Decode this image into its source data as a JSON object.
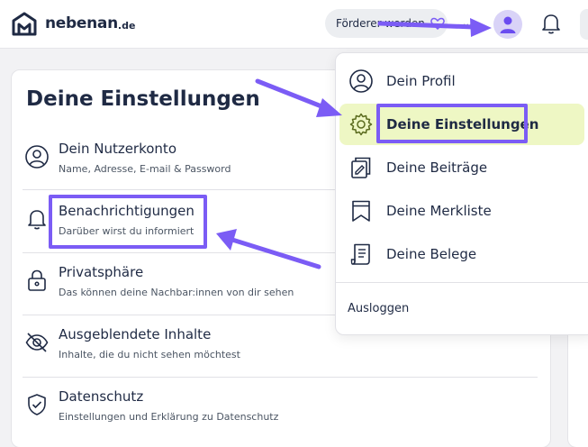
{
  "header": {
    "logo_text": "nebenan",
    "logo_tld": ".de",
    "supporter_label": "Förderer werden",
    "partial_text": "..."
  },
  "settings": {
    "title": "Deine Einstellungen",
    "items": [
      {
        "title": "Dein Nutzerkonto",
        "subtitle": "Name, Adresse, E-mail & Password",
        "icon": "user-circle-icon"
      },
      {
        "title": "Benachrichtigungen",
        "subtitle": "Darüber wirst du informiert",
        "icon": "bell-icon"
      },
      {
        "title": "Privatsphäre",
        "subtitle": "Das können deine Nachbar:innen von dir sehen",
        "icon": "lock-icon"
      },
      {
        "title": "Ausgeblendete Inhalte",
        "subtitle": "Inhalte, die du nicht sehen möchtest",
        "icon": "eye-off-icon"
      },
      {
        "title": "Datenschutz",
        "subtitle": "Einstellungen und Erklärung zu Datenschutz",
        "icon": "shield-check-icon"
      }
    ]
  },
  "dropdown": {
    "items": [
      {
        "label": "Dein Profil",
        "icon": "user-circle-icon"
      },
      {
        "label": "Deine Einstellungen",
        "icon": "gear-icon",
        "active": true
      },
      {
        "label": "Deine Beiträge",
        "icon": "posts-icon"
      },
      {
        "label": "Deine Merkliste",
        "icon": "bookmark-icon"
      },
      {
        "label": "Deine Belege",
        "icon": "receipt-icon"
      }
    ],
    "logout_label": "Ausloggen"
  },
  "colors": {
    "accent": "#7b5cf5",
    "active_bg": "#eef7c4",
    "text": "#1f2a44"
  }
}
